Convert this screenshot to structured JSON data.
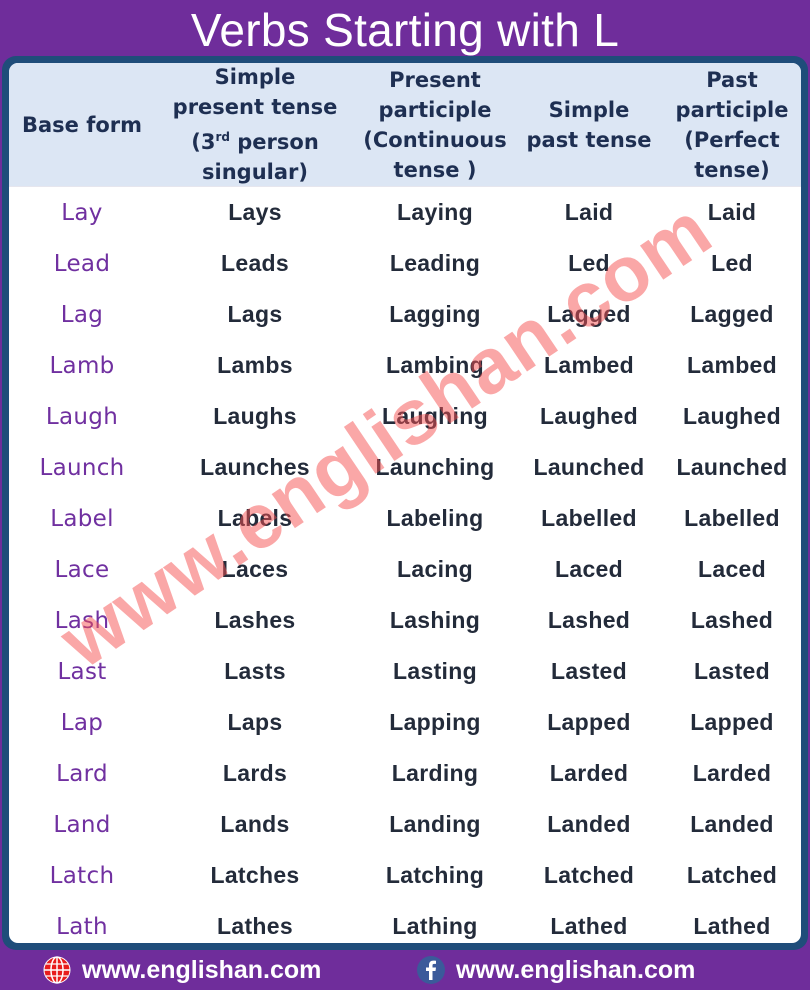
{
  "title": "Verbs Starting with L",
  "colors": {
    "background": "#6f2d9b",
    "panel_border": "#1f4d7a",
    "header_bg": "#dce6f4",
    "header_text": "#1e2f52",
    "base_form_text": "#7030a0",
    "cell_text": "#232b3a",
    "watermark": "#f55050"
  },
  "table": {
    "headers": [
      {
        "label": "Base form"
      },
      {
        "label": "Simple\npresent tense\n(3",
        "sup": "rd",
        "label_after": " person\nsingular)"
      },
      {
        "label": "Present\nparticiple\n(Continuous\ntense )"
      },
      {
        "label": "Simple\npast tense"
      },
      {
        "label": "Past\nparticiple\n(Perfect\ntense)"
      }
    ],
    "rows": [
      [
        "Lay",
        "Lays",
        "Laying",
        "Laid",
        "Laid"
      ],
      [
        "Lead",
        "Leads",
        "Leading",
        "Led",
        "Led"
      ],
      [
        "Lag",
        "Lags",
        "Lagging",
        "Lagged",
        "Lagged"
      ],
      [
        "Lamb",
        "Lambs",
        "Lambing",
        "Lambed",
        "Lambed"
      ],
      [
        "Laugh",
        "Laughs",
        "Laughing",
        "Laughed",
        "Laughed"
      ],
      [
        "Launch",
        "Launches",
        "Launching",
        "Launched",
        "Launched"
      ],
      [
        "Label",
        "Labels",
        "Labeling",
        "Labelled",
        "Labelled"
      ],
      [
        "Lace",
        "Laces",
        "Lacing",
        "Laced",
        "Laced"
      ],
      [
        "Lash",
        "Lashes",
        "Lashing",
        "Lashed",
        "Lashed"
      ],
      [
        "Last",
        "Lasts",
        "Lasting",
        "Lasted",
        "Lasted"
      ],
      [
        "Lap",
        "Laps",
        "Lapping",
        "Lapped",
        "Lapped"
      ],
      [
        "Lard",
        "Lards",
        "Larding",
        "Larded",
        "Larded"
      ],
      [
        "Land",
        "Lands",
        "Landing",
        "Landed",
        "Landed"
      ],
      [
        "Latch",
        "Latches",
        "Latching",
        "Latched",
        "Latched"
      ],
      [
        "Lath",
        "Lathes",
        "Lathing",
        "Lathed",
        "Lathed"
      ]
    ]
  },
  "watermark": "www.englishan.com",
  "footer": {
    "left": {
      "icon": "globe-icon",
      "text": "www.englishan.com"
    },
    "right": {
      "icon": "facebook-icon",
      "text": "www.englishan.com"
    }
  }
}
